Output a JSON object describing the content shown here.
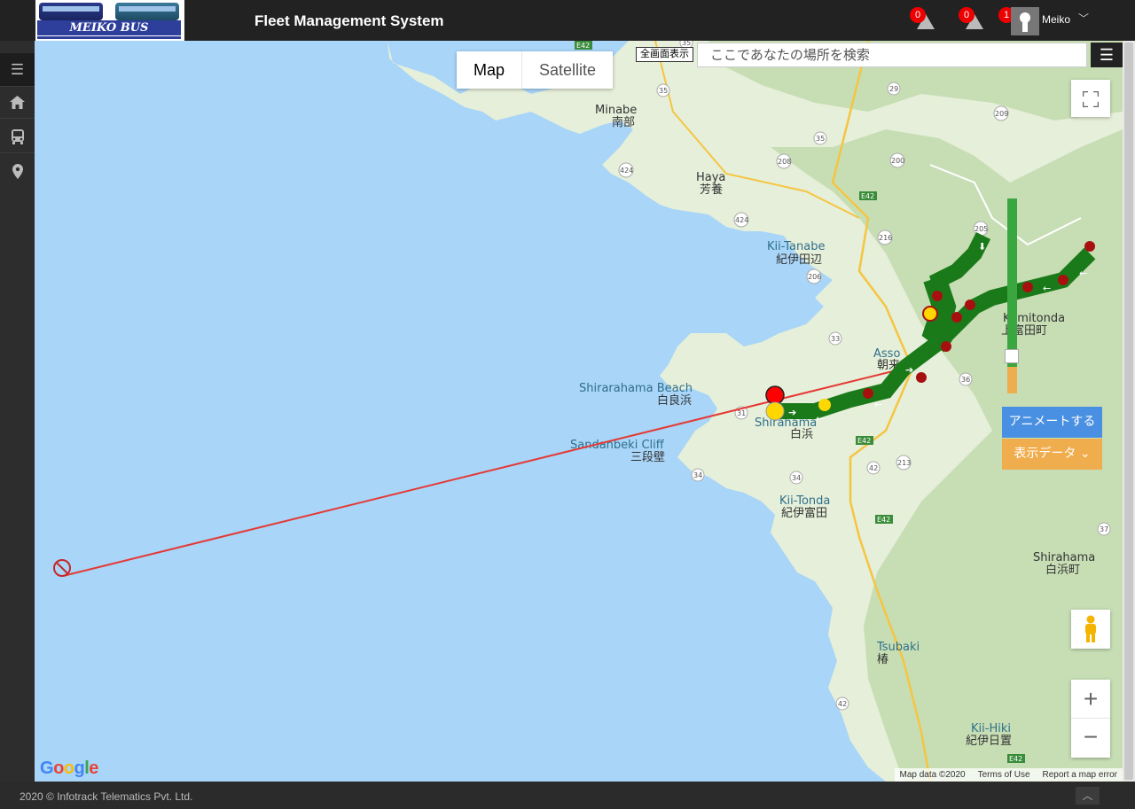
{
  "header": {
    "logo_text": "MEIKO BUS",
    "app_title": "Fleet Management System",
    "alerts": [
      {
        "count": "0",
        "icon": "warning-icon"
      },
      {
        "count": "0",
        "icon": "warning-icon"
      },
      {
        "count": "1",
        "icon": "warning-icon"
      }
    ],
    "user": {
      "name": "Meiko",
      "icon": "user-avatar-icon"
    }
  },
  "sidebar": {
    "items": [
      {
        "icon": "hamburger-icon",
        "glyph": "☰"
      },
      {
        "icon": "home-icon",
        "glyph": "⌂"
      },
      {
        "icon": "bus-icon",
        "glyph": "🚌"
      },
      {
        "icon": "map-pin-icon",
        "glyph": "⚲"
      }
    ]
  },
  "map": {
    "type_control": {
      "map": "Map",
      "satellite": "Satellite",
      "selected": "Map"
    },
    "fullscreen_label": "全画面表示",
    "search_placeholder": "ここであなたの場所を検索",
    "animate_button": "アニメートする",
    "display_data_button": "表示データ",
    "google_logo": "Google",
    "attribution": {
      "map_data": "Map data ©2020",
      "terms": "Terms of Use",
      "report": "Report a map error"
    },
    "places": [
      {
        "en": "Minabe",
        "ja": "南部"
      },
      {
        "en": "Haya",
        "ja": "芳養"
      },
      {
        "en": "Kii-Tanabe",
        "ja": "紀伊田辺"
      },
      {
        "en": "Shirarahama Beach",
        "ja": "白良浜"
      },
      {
        "en": "Sandanbeki Cliff",
        "ja": "三段壁"
      },
      {
        "en": "Shirahama",
        "ja": "白浜"
      },
      {
        "en": "Asso",
        "ja": "朝来"
      },
      {
        "en": "Kamitonda",
        "ja": "上富田町"
      },
      {
        "en": "Kii-Tonda",
        "ja": "紀伊富田"
      },
      {
        "en": "Shirahama",
        "ja": "白浜町"
      },
      {
        "en": "Tsubaki",
        "ja": "椿"
      },
      {
        "en": "Kii-Hiki",
        "ja": "紀伊日置"
      }
    ],
    "route_numbers": [
      "E42",
      "35",
      "29",
      "209",
      "218",
      "424",
      "35",
      "208",
      "200",
      "E42",
      "424",
      "216",
      "205",
      "206",
      "33",
      "36",
      "31",
      "34",
      "42",
      "213",
      "E42",
      "37",
      "42",
      "E42"
    ],
    "colors": {
      "water": "#a8d5f8",
      "land": "#e6efd9",
      "forest": "#c7deb5",
      "route": "#1a7a1a",
      "line": "#e53935",
      "start": "#ff0000",
      "end": "#ffd700"
    }
  },
  "footer": {
    "copyright": "2020 © Infotrack Telematics Pvt. Ltd."
  }
}
